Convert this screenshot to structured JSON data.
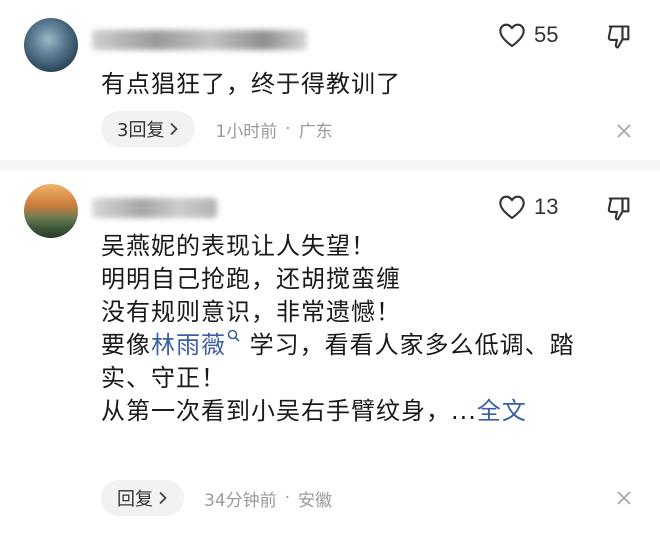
{
  "comments": [
    {
      "likes": "55",
      "body": [
        "有点猖狂了，终于得教训了"
      ],
      "reply_label": "3回复",
      "time": "1小时前",
      "location": "广东"
    },
    {
      "likes": "13",
      "body_lines": [
        "吴燕妮的表现让人失望！",
        "明明自己抢跑，还胡搅蛮缠",
        "没有规则意识，非常遗憾！"
      ],
      "line4_prefix": "要像",
      "line4_link": "林雨薇",
      "line4_suffix": "学习，看看人家多么低调、踏",
      "line5": "实、守正！",
      "line6_text": "从第一次看到小吴右手臂纹身，",
      "line6_ellipsis": "...",
      "full_text_label": "全文",
      "reply_label": "回复",
      "time": "34分钟前",
      "location": "安徽"
    }
  ],
  "meta_separator": "·",
  "icons": {
    "like": "heart-icon",
    "dislike": "thumbs-down-icon",
    "reply_arrow": "chevron-right-icon",
    "close": "close-icon",
    "link_search": "search-icon"
  },
  "colors": {
    "link": "#3d5fa3",
    "meta": "#9a9a9a"
  }
}
